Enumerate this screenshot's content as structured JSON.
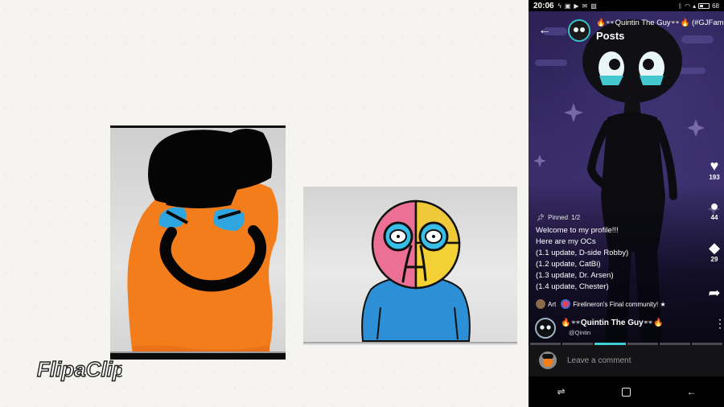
{
  "status_bar": {
    "time": "20:06",
    "battery": "68"
  },
  "header": {
    "user_name": "🔥👓Quintin The Guy👓🔥 (#GJFamous)",
    "section": "Posts"
  },
  "actions": {
    "likes": "193",
    "comments": "44",
    "reposts": "29"
  },
  "post": {
    "pinned_label": "Pinned",
    "page": "1/2",
    "caption_lines": [
      "Welcome to my profile!!!",
      "Here are my OCs",
      "(1.1 update, D-side Robby)",
      "(1.2 update, CatBi)",
      "(1.3 update, Dr. Arsen)",
      "(1.4 update, Chester)"
    ],
    "tags": [
      "Art",
      "Firelineron's Final community! ★"
    ]
  },
  "author": {
    "name": "🔥👓Quintin The Guy👓🔥",
    "handle": "@Qintin"
  },
  "comment": {
    "placeholder": "Leave a comment"
  },
  "watermark": "FlipaClip",
  "colors": {
    "accent": "#3cd0d6",
    "orange_character": "#f27d1a",
    "background_purple": "#2b2156"
  }
}
